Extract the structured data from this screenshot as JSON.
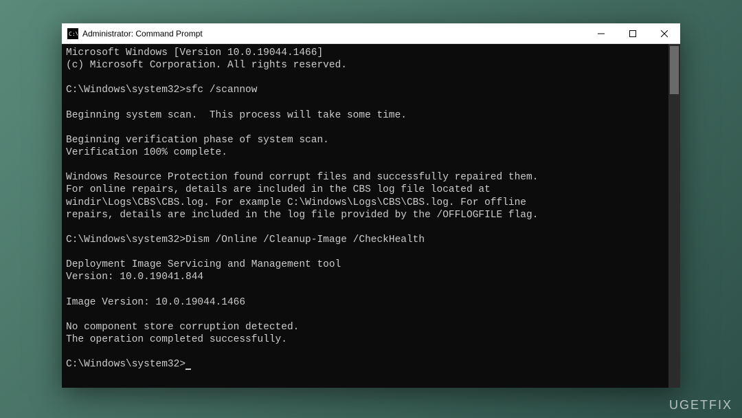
{
  "window": {
    "title": "Administrator: Command Prompt",
    "icon_label": "C:\\"
  },
  "terminal": {
    "lines": [
      "Microsoft Windows [Version 10.0.19044.1466]",
      "(c) Microsoft Corporation. All rights reserved.",
      "",
      "C:\\Windows\\system32>sfc /scannow",
      "",
      "Beginning system scan.  This process will take some time.",
      "",
      "Beginning verification phase of system scan.",
      "Verification 100% complete.",
      "",
      "Windows Resource Protection found corrupt files and successfully repaired them.",
      "For online repairs, details are included in the CBS log file located at",
      "windir\\Logs\\CBS\\CBS.log. For example C:\\Windows\\Logs\\CBS\\CBS.log. For offline",
      "repairs, details are included in the log file provided by the /OFFLOGFILE flag.",
      "",
      "C:\\Windows\\system32>Dism /Online /Cleanup-Image /CheckHealth",
      "",
      "Deployment Image Servicing and Management tool",
      "Version: 10.0.19041.844",
      "",
      "Image Version: 10.0.19044.1466",
      "",
      "No component store corruption detected.",
      "The operation completed successfully.",
      "",
      "C:\\Windows\\system32>"
    ]
  },
  "watermark": "UGETFIX"
}
